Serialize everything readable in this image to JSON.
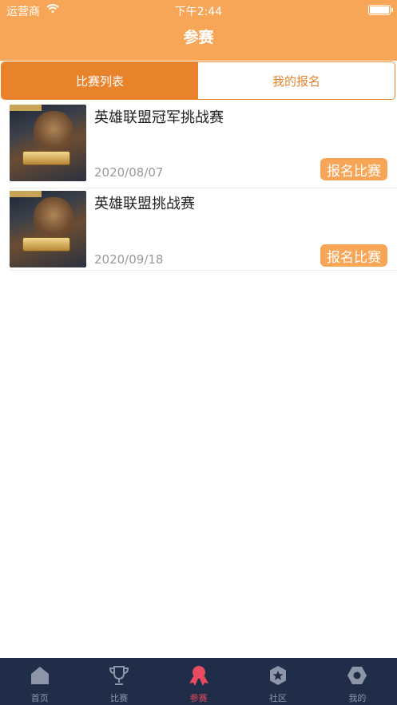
{
  "status_bar": {
    "carrier": "运营商",
    "time": "下午2:44"
  },
  "header": {
    "title": "参赛"
  },
  "segments": [
    {
      "label": "比赛列表",
      "active": true
    },
    {
      "label": "我的报名",
      "active": false
    }
  ],
  "matches": [
    {
      "title": "英雄联盟冠军挑战赛",
      "date": "2020/08/07",
      "button": "报名比赛"
    },
    {
      "title": "英雄联盟挑战赛",
      "date": "2020/09/18",
      "button": "报名比赛"
    }
  ],
  "tabbar": [
    {
      "label": "首页",
      "icon": "home-icon"
    },
    {
      "label": "比赛",
      "icon": "trophy-icon"
    },
    {
      "label": "参赛",
      "icon": "medal-icon",
      "active": true
    },
    {
      "label": "社区",
      "icon": "star-badge-icon"
    },
    {
      "label": "我的",
      "icon": "hexagon-nut-icon"
    }
  ],
  "colors": {
    "accent": "#f7a556",
    "segment_active": "#e8832c",
    "tabbar_bg": "#1f2d49",
    "tab_active": "#e84a5f"
  }
}
